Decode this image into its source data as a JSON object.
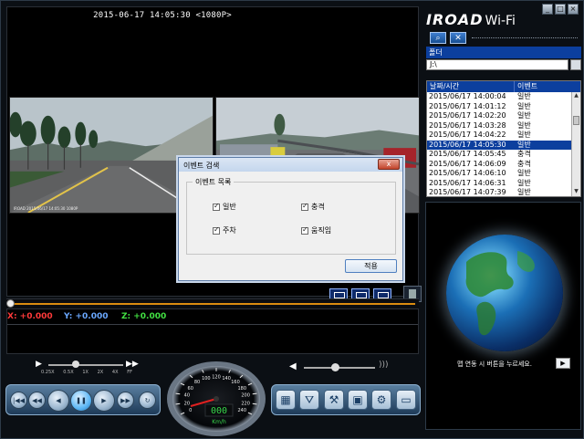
{
  "video": {
    "timestamp": "2015-06-17 14:05:30 <1080P>",
    "caption": "IROAD 2015/06/17 14:05:30 1080P"
  },
  "gsensor": {
    "x": "X: +0.000",
    "y": "Y: +0.000",
    "z": "Z: +0.000"
  },
  "playback": {
    "speed_options": [
      "0.25X",
      "0.5X",
      "1X",
      "2X",
      "4X",
      "FF"
    ],
    "selected_speed": "1X"
  },
  "speedometer": {
    "ticks": [
      "0",
      "20",
      "40",
      "60",
      "80",
      "100",
      "120",
      "140",
      "160",
      "180",
      "200",
      "220",
      "240"
    ],
    "speed": "000",
    "unit": "Km/h"
  },
  "brand": {
    "name": "IROAD",
    "sub": "Wi-Fi"
  },
  "window": {
    "minimize": "_",
    "maximize": "□",
    "close": "×"
  },
  "panel": {
    "folder_label": "폴더",
    "folder_value": "J:\\",
    "col_time": "날짜/시간",
    "col_event": "이벤트",
    "rows": [
      {
        "time": "2015/06/17 14:00:04",
        "event": "일반"
      },
      {
        "time": "2015/06/17 14:01:12",
        "event": "일반"
      },
      {
        "time": "2015/06/17 14:02:20",
        "event": "일반"
      },
      {
        "time": "2015/06/17 14:03:28",
        "event": "일반"
      },
      {
        "time": "2015/06/17 14:04:22",
        "event": "일반"
      },
      {
        "time": "2015/06/17 14:05:30",
        "event": "일반"
      },
      {
        "time": "2015/06/17 14:05:45",
        "event": "충격"
      },
      {
        "time": "2015/06/17 14:06:09",
        "event": "충격"
      },
      {
        "time": "2015/06/17 14:06:10",
        "event": "일반"
      },
      {
        "time": "2015/06/17 14:06:31",
        "event": "일반"
      },
      {
        "time": "2015/06/17 14:07:39",
        "event": "일반"
      }
    ],
    "selected_index": 5
  },
  "map": {
    "hint": "맵 연동 시 버튼을 누르세요.",
    "play": "▶"
  },
  "dialog": {
    "title": "이벤트 검색",
    "close": "x",
    "group": "이벤트 목록",
    "options": {
      "normal": "일반",
      "impact": "충격",
      "parking": "주차",
      "motion": "움직임"
    },
    "apply": "적용"
  },
  "colors": {
    "gx": "#ff3a3a",
    "gy": "#6aa8ff",
    "gz": "#42e042",
    "selection": "#0c3f9e",
    "seek": "#d98c10",
    "speed_digits": "#37d64a"
  },
  "icons": {
    "transport": [
      "skip-start-icon",
      "rewind-icon",
      "prev-frame-icon",
      "pause-icon",
      "play-icon",
      "next-frame-icon",
      "skip-end-icon",
      "loop-icon"
    ],
    "tools": [
      "film-icon",
      "road-icon",
      "tools-icon",
      "save-icon",
      "gear-icon",
      "folder-icon"
    ]
  }
}
